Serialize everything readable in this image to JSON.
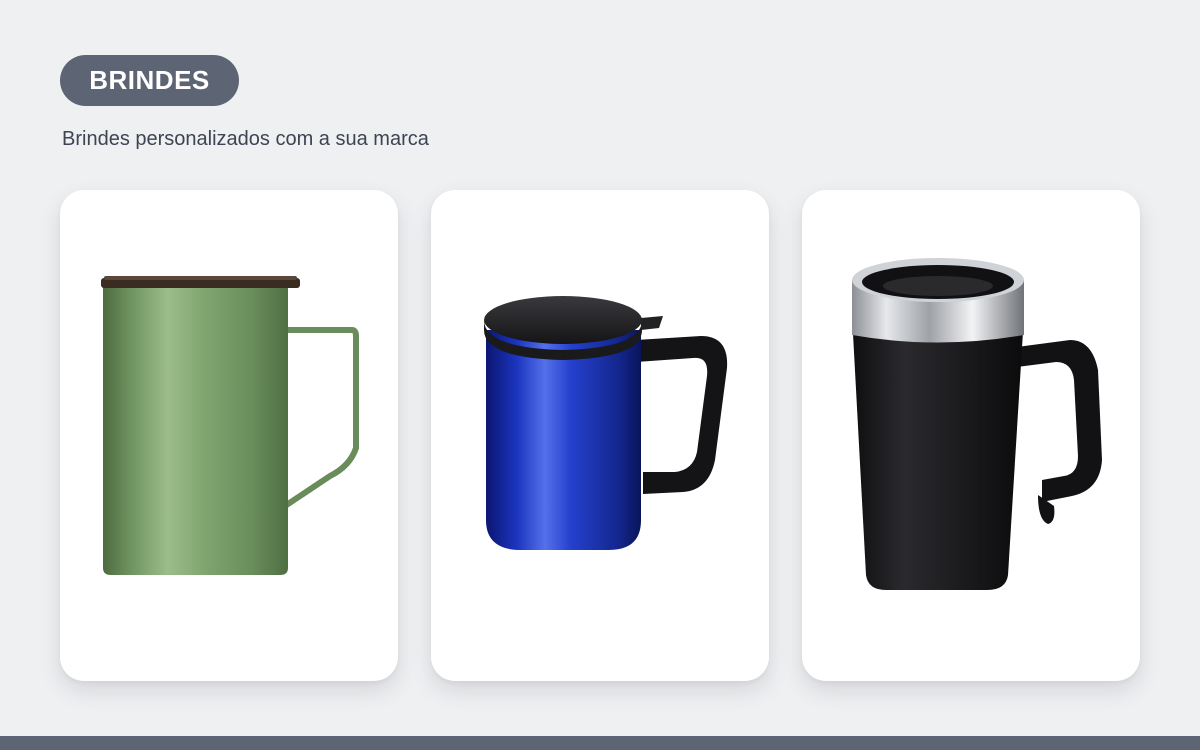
{
  "header": {
    "badge_label": "BRINDES",
    "subtitle": "Brindes personalizados com a sua marca"
  },
  "products": [
    {
      "image": "green-stainless-camp-mug",
      "color": "#7fa06c"
    },
    {
      "image": "blue-thermal-mug-with-lid",
      "color": "#1a33b8"
    },
    {
      "image": "black-thermal-travel-mug",
      "color": "#1f1f22"
    }
  ],
  "colors": {
    "background": "#eff0f2",
    "accent": "#5d6575",
    "text": "#3d4452",
    "card": "#ffffff"
  }
}
